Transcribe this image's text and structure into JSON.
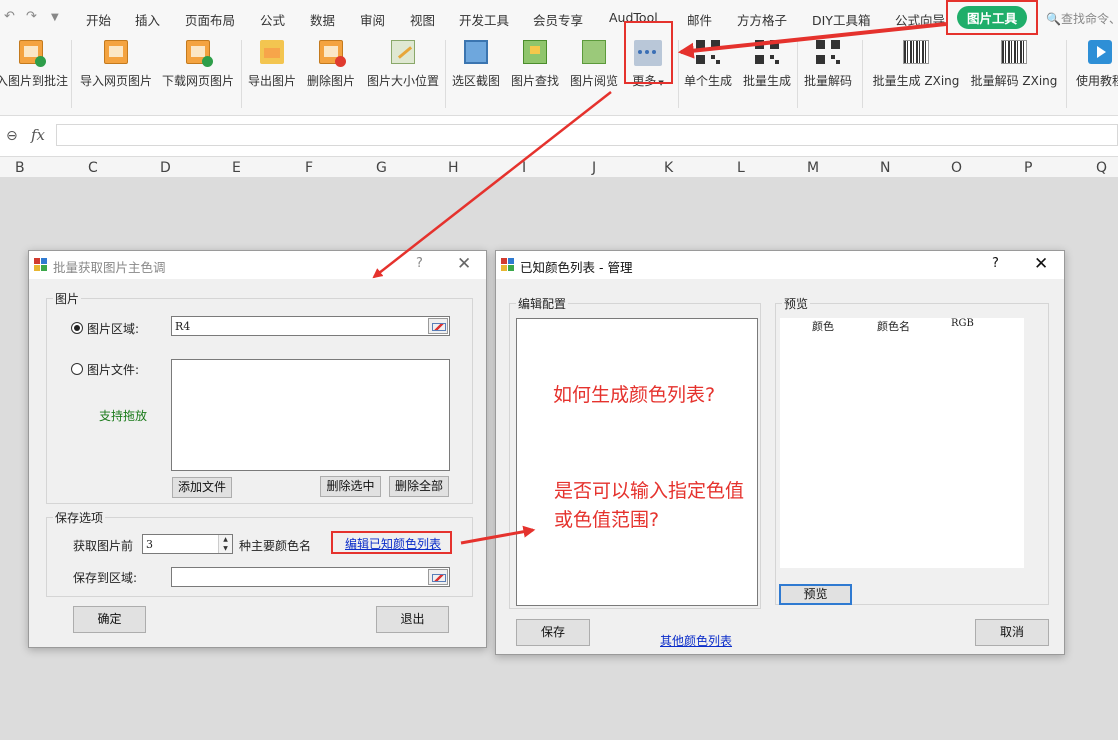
{
  "tabs": {
    "items": [
      "开始",
      "插入",
      "页面布局",
      "公式",
      "数据",
      "审阅",
      "视图",
      "开发工具",
      "会员专享",
      "AudTool",
      "邮件",
      "方方格子",
      "DIY工具箱",
      "公式向导"
    ],
    "active": "图片工具",
    "search_placeholder": "查找命令、"
  },
  "ribbon": {
    "insert_comment": "入图片到批注",
    "import_web": "导入网页图片",
    "download_web": "下载网页图片",
    "export_img": "导出图片",
    "delete_img": "删除图片",
    "resize_img": "图片大小位置",
    "screenshot": "选区截图",
    "find_img": "图片查找",
    "view_img": "图片阅览",
    "more": "更多",
    "single_gen": "单个生成",
    "batch_gen": "批量生成",
    "batch_decode": "批量解码",
    "batch_gen_zx": "批量生成 ZXing",
    "batch_decode_zx": "批量解码 ZXing",
    "tutorial": "使用教程"
  },
  "formula_bar": {
    "fx": "fx"
  },
  "columns": [
    "B",
    "C",
    "D",
    "E",
    "F",
    "G",
    "H",
    "I",
    "J",
    "K",
    "L",
    "M",
    "N",
    "O",
    "P",
    "Q"
  ],
  "dlg1": {
    "title": "批量获取图片主色调",
    "help": "?",
    "close": "✕",
    "group_image": "图片",
    "radio_range": "图片区域:",
    "range_value": "R4",
    "radio_file": "图片文件:",
    "drag_hint": "支持拖放",
    "add_file": "添加文件",
    "delete_selected": "删除选中",
    "delete_all": "删除全部",
    "group_save": "保存选项",
    "take_before": "获取图片前",
    "count_value": "3",
    "main_colors": "种主要颜色名",
    "edit_link": "编辑已知颜色列表",
    "save_to": "保存到区域:",
    "ok": "确定",
    "exit": "退出"
  },
  "dlg2": {
    "title": "已知颜色列表 - 管理",
    "help": "?",
    "close": "✕",
    "group_edit": "编辑配置",
    "group_preview": "预览",
    "col_color": "颜色",
    "col_name": "颜色名",
    "col_rgb": "RGB",
    "preview_btn": "预览",
    "save": "保存",
    "other_link": "其他颜色列表",
    "cancel": "取消"
  },
  "annotations": {
    "q1": "如何生成颜色列表?",
    "q2a": "是否可以输入指定色值",
    "q2b": "或色值范围?"
  },
  "colors": {
    "accent_green": "#1fae6a",
    "highlight_red": "#e5322d"
  }
}
